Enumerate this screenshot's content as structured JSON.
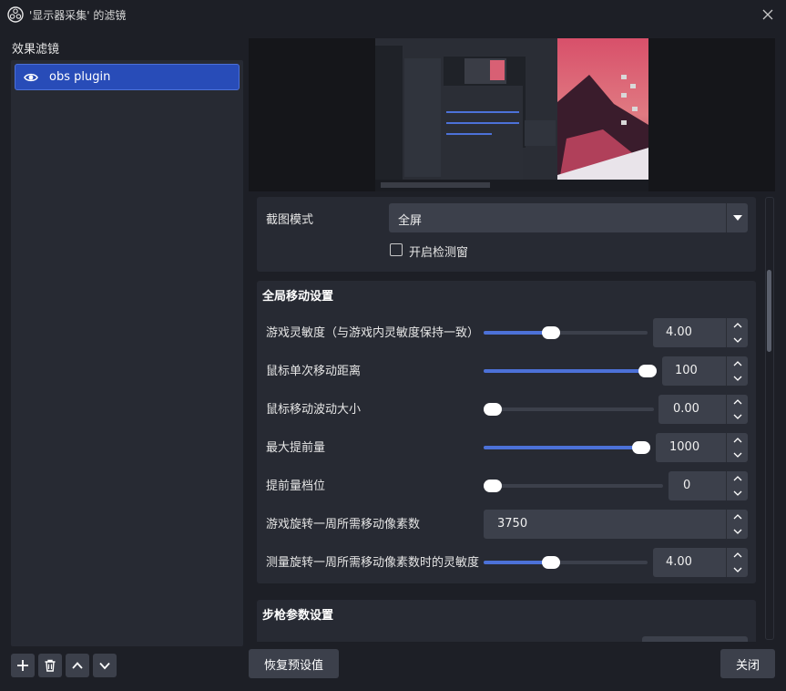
{
  "window": {
    "title": "'显示器采集' 的滤镜",
    "close_icon": "close-icon",
    "app_icon": "obs-logo-icon"
  },
  "left_panel": {
    "label": "效果滤镜",
    "filters": [
      {
        "name": "obs plugin",
        "visible": true,
        "selected": true
      }
    ],
    "toolbar": {
      "add_icon": "plus-icon",
      "remove_icon": "trash-icon",
      "move_up_icon": "chevron-up-icon",
      "move_down_icon": "chevron-down-icon"
    }
  },
  "capture": {
    "mode_label": "截图模式",
    "mode_value": "全屏",
    "detect_window_label": "开启检测窗",
    "detect_window_checked": false
  },
  "global_move": {
    "title": "全局移动设置",
    "props": [
      {
        "label": "游戏灵敏度（与游戏内灵敏度保持一致）",
        "value": "4.00",
        "fraction": 0.4,
        "slider": true
      },
      {
        "label": "鼠标单次移动距离",
        "value": "100",
        "fraction": 1.0,
        "slider": true
      },
      {
        "label": "鼠标移动波动大小",
        "value": "0.00",
        "fraction": 0.0,
        "slider": true
      },
      {
        "label": "最大提前量",
        "value": "1000",
        "fraction": 1.0,
        "slider": true
      },
      {
        "label": "提前量档位",
        "value": "0",
        "fraction": 0.0,
        "slider": true
      },
      {
        "label": "游戏旋转一周所需移动像素数",
        "value": "3750",
        "slider": false
      },
      {
        "label": "测量旋转一周所需移动像素数时的灵敏度",
        "value": "4.00",
        "fraction": 0.4,
        "slider": true
      }
    ]
  },
  "rifle": {
    "title": "步枪参数设置"
  },
  "footer": {
    "restore_defaults": "恢复预设值",
    "close": "关闭"
  },
  "colors": {
    "accent": "#4c71d8",
    "selected_item": "#284cb8",
    "panel": "#272a33",
    "control": "#3c404b",
    "background": "#1d1f26"
  }
}
